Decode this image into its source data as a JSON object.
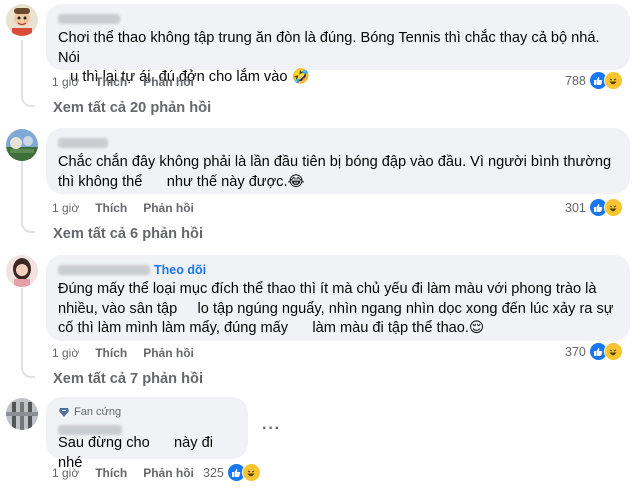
{
  "comments": [
    {
      "text": "Chơi thể thao không tập trung ăn đòn là đúng. Bóng Tennis thì chắc thay cả bộ nhá. Nói\n   u thì lại tự ái, đú đởn cho lắm vào 🤣",
      "time": "1 giờ",
      "like_label": "Thích",
      "reply_label": "Phản hồi",
      "reaction_count": "788",
      "view_replies": "Xem tất cả 20 phản hồi"
    },
    {
      "text": "Chắc chắn đây không phải là lần đầu tiên bị bóng đập vào đầu. Vì người bình thường\nthì không thể      như thế này được.😂",
      "time": "1 giờ",
      "like_label": "Thích",
      "reply_label": "Phản hồi",
      "reaction_count": "301",
      "view_replies": "Xem tất cả 6 phản hồi"
    },
    {
      "follow_label": "Theo dõi",
      "text": "Đúng mấy thể loại mục đích thể thao thì ít mà chủ yếu đi làm màu với phong trào là\nnhiều, vào sân tập     lo tập ngúng nguẩy, nhìn ngang nhìn dọc xong đến lúc xảy ra sự\ncố thì làm mình làm mẩy, đúng mấy      làm màu đi tập thể thao.😌",
      "time": "1 giờ",
      "like_label": "Thích",
      "reply_label": "Phản hồi",
      "reaction_count": "370",
      "view_replies": "Xem tất cả 7 phản hồi"
    },
    {
      "badge_label": "Fan cứng",
      "text": "Sau đừng cho      này đi nhé",
      "time": "1 giờ",
      "like_label": "Thích",
      "reply_label": "Phản hồi",
      "reaction_count": "325"
    }
  ],
  "more_options": "···",
  "colors": {
    "bubble": "#f0f2f5",
    "meta": "#65676b",
    "link": "#1877f2",
    "like": "#1877f2",
    "haha": "#f7c531"
  },
  "icons": [
    "like-icon",
    "haha-icon",
    "fan-badge-icon",
    "more-options-icon"
  ]
}
